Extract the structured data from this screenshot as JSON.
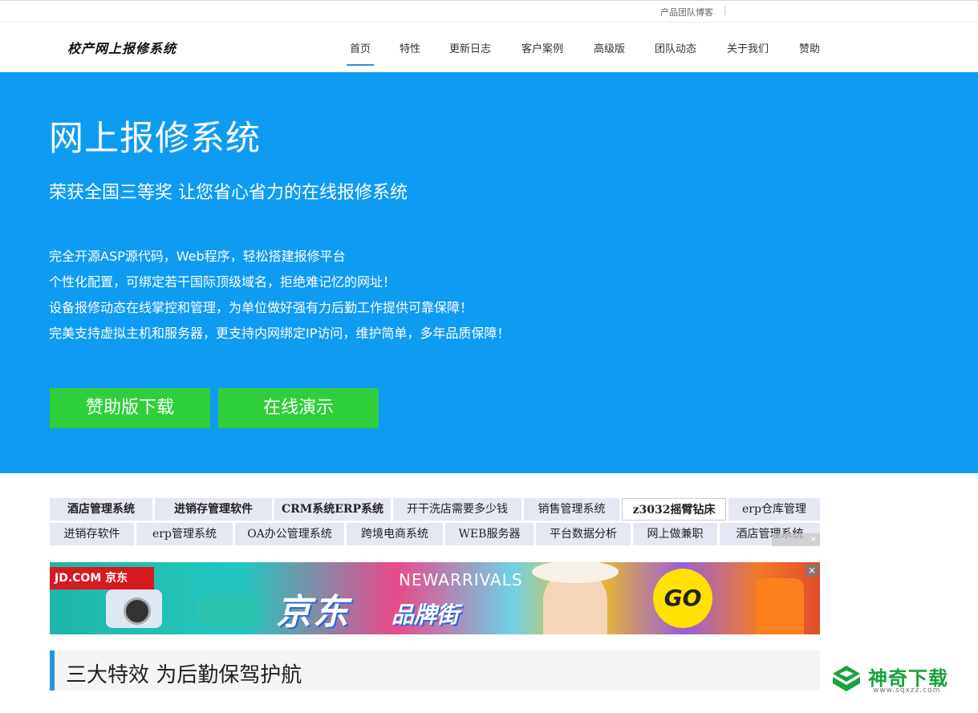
{
  "topbar": {
    "blog_link": "产品团队博客",
    "separator": "|"
  },
  "header": {
    "logo": "校产网上报修系统",
    "nav": [
      {
        "label": "首页",
        "active": true
      },
      {
        "label": "特性"
      },
      {
        "label": "更新日志"
      },
      {
        "label": "客户案例"
      },
      {
        "label": "高级版"
      },
      {
        "label": "团队动态"
      },
      {
        "label": "关于我们"
      },
      {
        "label": "赞助"
      }
    ]
  },
  "hero": {
    "title": "网上报修系统",
    "subtitle": "荣获全国三等奖 让您省心省力的在线报修系统",
    "features": [
      "完全开源ASP源代码，Web程序，轻松搭建报修平台",
      "个性化配置，可绑定若干国际顶级域名，拒绝难记忆的网址！",
      "设备报修动态在线掌控和管理，为单位做好强有力后勤工作提供可靠保障！",
      "完美支持虚拟主机和服务器，更支持内网绑定IP访问，维护简单，多年品质保障！"
    ],
    "download_button": "赞助版下载",
    "demo_button": "在线演示",
    "background_color": "#0e9cf3",
    "button_color": "#2fcf3c"
  },
  "ad_links": {
    "row1": [
      "酒店管理系统",
      "进销存管理软件",
      "CRM系统ERP系统",
      "开干洗店需要多少钱",
      "销售管理系统",
      "z3032摇臂钻床",
      "erp仓库管理"
    ],
    "row2": [
      "进销存软件",
      "erp管理系统",
      "OA办公管理系统",
      "跨境电商系统",
      "WEB服务器",
      "平台数据分析",
      "网上做兼职",
      "酒店管理系统"
    ],
    "close_label": "×"
  },
  "banner": {
    "brand": "JD.COM 京东",
    "headline": "京东",
    "subheadline": "品牌街",
    "tagline": "NEWARRIVALS",
    "go": "GO",
    "close": "×"
  },
  "section": {
    "title": "三大特效 为后勤保驾护航",
    "accent_color": "#1e97e0"
  },
  "watermark": {
    "name": "神奇下载",
    "url": "www.sqxzz.com"
  }
}
